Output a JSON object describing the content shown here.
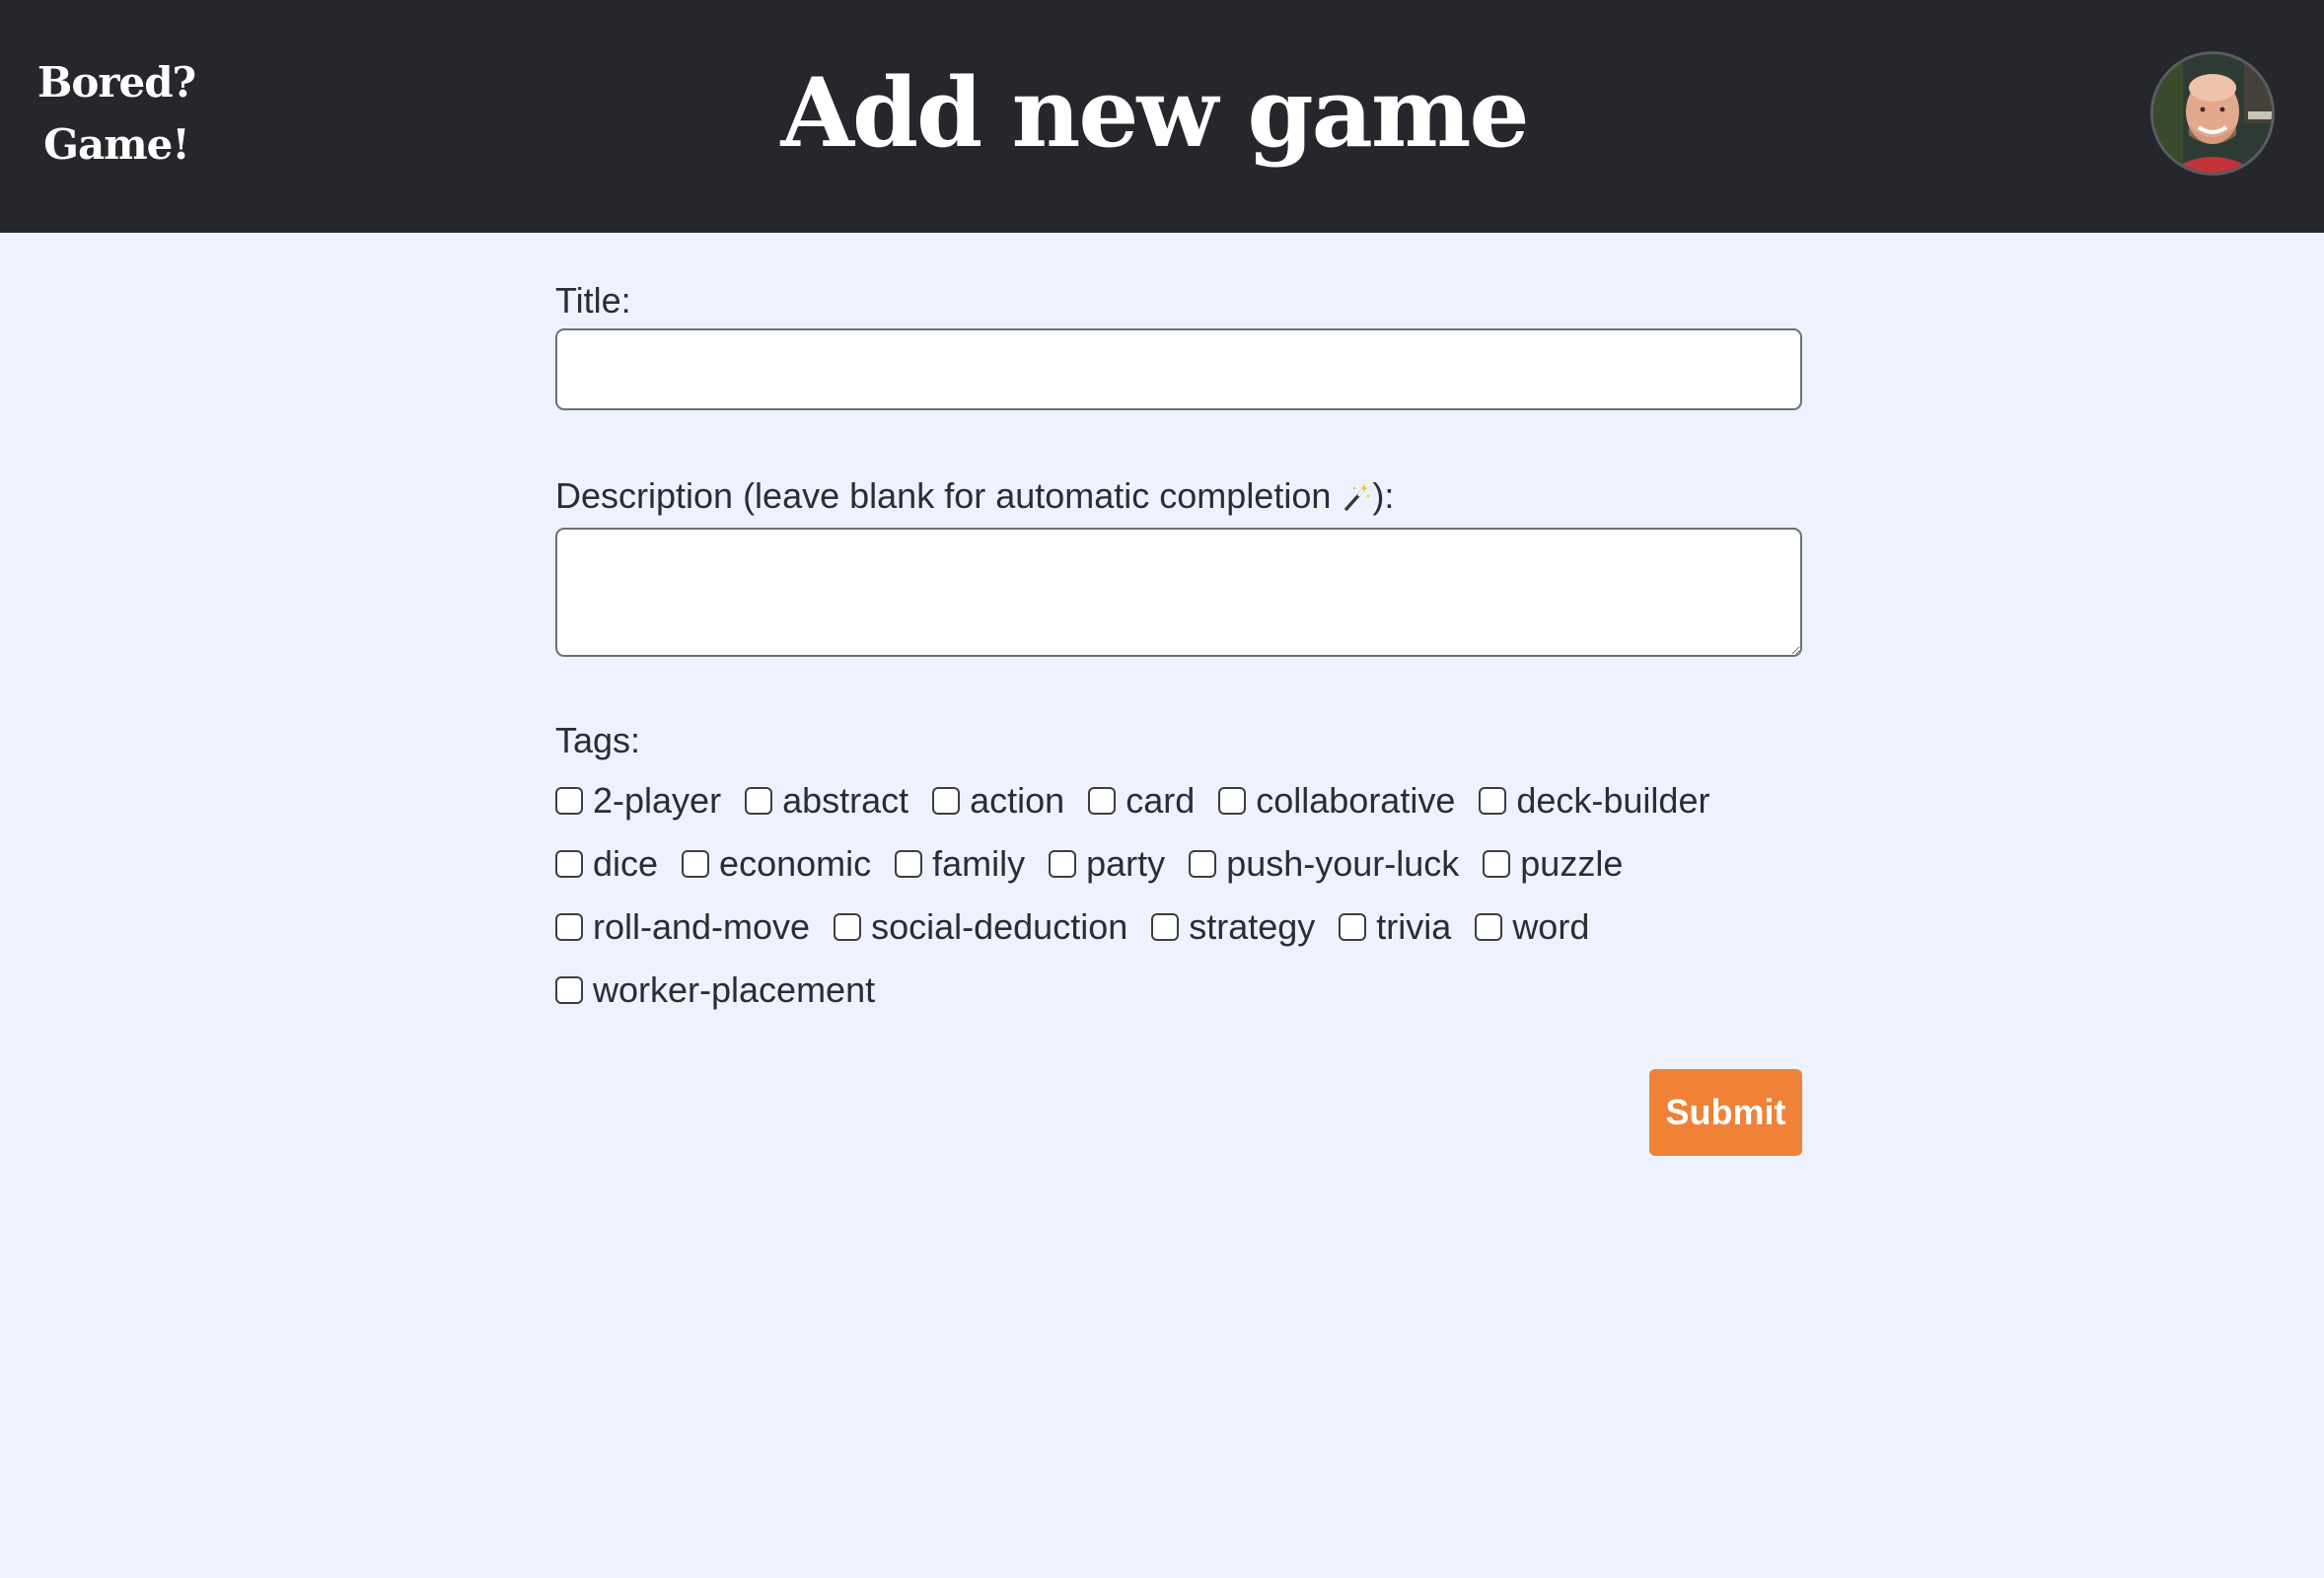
{
  "header": {
    "logo_line1": "Bored?",
    "logo_line2": "Game!",
    "title": "Add new game",
    "avatar_alt": "User avatar"
  },
  "form": {
    "title_label": "Title:",
    "title_value": "",
    "description_label_prefix": "Description (leave blank for automatic completion ",
    "description_label_suffix": "):",
    "description_value": "",
    "tags_label": "Tags:",
    "tags": [
      {
        "label": "2-player",
        "checked": false
      },
      {
        "label": "abstract",
        "checked": false
      },
      {
        "label": "action",
        "checked": false
      },
      {
        "label": "card",
        "checked": false
      },
      {
        "label": "collaborative",
        "checked": false
      },
      {
        "label": "deck-builder",
        "checked": false
      },
      {
        "label": "dice",
        "checked": false
      },
      {
        "label": "economic",
        "checked": false
      },
      {
        "label": "family",
        "checked": false
      },
      {
        "label": "party",
        "checked": false
      },
      {
        "label": "push-your-luck",
        "checked": false
      },
      {
        "label": "puzzle",
        "checked": false
      },
      {
        "label": "roll-and-move",
        "checked": false
      },
      {
        "label": "social-deduction",
        "checked": false
      },
      {
        "label": "strategy",
        "checked": false
      },
      {
        "label": "trivia",
        "checked": false
      },
      {
        "label": "word",
        "checked": false
      },
      {
        "label": "worker-placement",
        "checked": false
      }
    ],
    "submit_label": "Submit"
  },
  "colors": {
    "header_bg": "#26272d",
    "page_bg": "#eef2fe",
    "accent": "#f08237"
  },
  "icons": {
    "description_label_icon": "magic-wand-icon"
  }
}
